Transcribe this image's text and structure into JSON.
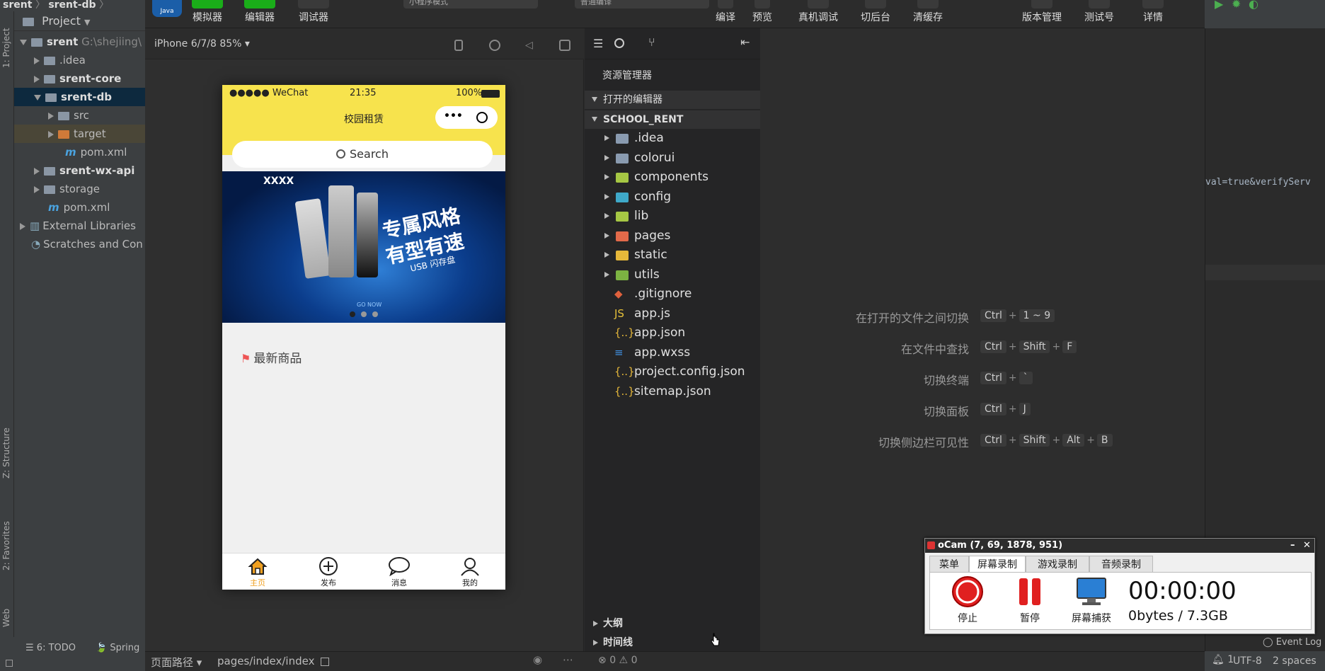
{
  "ij": {
    "breadcrumb": [
      "srent",
      "srent-db"
    ],
    "project_header": "Project",
    "side_tabs": {
      "project": "1: Project",
      "structure": "Z: Structure",
      "favorites": "2: Favorites",
      "web": "Web"
    },
    "tree": [
      {
        "label": "srent",
        "suffix": "G:\\shejiing\\",
        "expanded": true,
        "indent": 0
      },
      {
        "label": ".idea",
        "indent": 1
      },
      {
        "label": "srent-core",
        "indent": 1
      },
      {
        "label": "srent-db",
        "indent": 1,
        "expanded": true
      },
      {
        "label": "src",
        "indent": 2
      },
      {
        "label": "target",
        "indent": 2
      },
      {
        "label": "pom.xml",
        "indent": 2
      },
      {
        "label": "srent-wx-api",
        "indent": 1
      },
      {
        "label": "storage",
        "indent": 1
      },
      {
        "label": "pom.xml",
        "indent": 1
      },
      {
        "label": "External Libraries",
        "indent": 0
      },
      {
        "label": "Scratches and Con",
        "indent": 0
      }
    ],
    "bottom_tabs": {
      "todo": "6: TODO",
      "spring": "Spring"
    },
    "right": {
      "code_fragment": "val=true&verifyServ",
      "event_log": "Event Log",
      "encoding": "UTF-8",
      "indent": "2 spaces",
      "notif_count": "1"
    }
  },
  "toolbar": {
    "java_logo": "Java",
    "simulator": "模拟器",
    "editor": "编辑器",
    "debugger": "调试器",
    "mode_select": "小程序模式",
    "compile_select": "普通编译",
    "compile": "编译",
    "preview": "预览",
    "real_debug": "真机调试",
    "background": "切后台",
    "clear_cache": "清缓存",
    "version": "版本管理",
    "test_no": "测试号",
    "details": "详情"
  },
  "sim": {
    "device": "iPhone 6/7/8 85%",
    "phone": {
      "carrier": "●●●●● WeChat",
      "time": "21:35",
      "battery": "100%",
      "title": "校园租赁",
      "search": "Search",
      "banner_brand": "XXXX",
      "banner_line1": "专属风格",
      "banner_line2": "有型有速",
      "banner_line3": "USB 闪存盘",
      "banner_cta": "GO NOW",
      "latest": "最新商品",
      "tabs": [
        {
          "label": "主页",
          "icon": "home-icon"
        },
        {
          "label": "发布",
          "icon": "plus-circle-icon"
        },
        {
          "label": "消息",
          "icon": "chat-icon"
        },
        {
          "label": "我的",
          "icon": "user-icon"
        }
      ]
    }
  },
  "explorer": {
    "title": "资源管理器",
    "open_editors": "打开的编辑器",
    "project": "SCHOOL_RENT",
    "items": [
      {
        "label": ".idea",
        "type": "folder",
        "color": "#8a9bb0"
      },
      {
        "label": "colorui",
        "type": "folder",
        "color": "#8a9bb0"
      },
      {
        "label": "components",
        "type": "folder",
        "color": "#a6c744"
      },
      {
        "label": "config",
        "type": "folder",
        "color": "#3fa9c9"
      },
      {
        "label": "lib",
        "type": "folder",
        "color": "#a6c744"
      },
      {
        "label": "pages",
        "type": "folder",
        "color": "#e26a4a"
      },
      {
        "label": "static",
        "type": "folder",
        "color": "#e6b83a"
      },
      {
        "label": "utils",
        "type": "folder",
        "color": "#7cb342"
      },
      {
        "label": ".gitignore",
        "type": "file",
        "glyph": "◆",
        "color": "#e0613d"
      },
      {
        "label": "app.js",
        "type": "file",
        "glyph": "JS",
        "color": "#e6c13a"
      },
      {
        "label": "app.json",
        "type": "file",
        "glyph": "{..}",
        "color": "#e6b83a"
      },
      {
        "label": "app.wxss",
        "type": "file",
        "glyph": "≡",
        "color": "#3f8fe0"
      },
      {
        "label": "project.config.json",
        "type": "file",
        "glyph": "{..}",
        "color": "#e6b83a"
      },
      {
        "label": "sitemap.json",
        "type": "file",
        "glyph": "{..}",
        "color": "#e6b83a"
      }
    ],
    "outline": "大纲",
    "timeline": "时间线"
  },
  "editor": {
    "shortcuts": [
      {
        "label": "在打开的文件之间切换",
        "keys": [
          "Ctrl",
          "1 ~ 9"
        ]
      },
      {
        "label": "在文件中查找",
        "keys": [
          "Ctrl",
          "Shift",
          "F"
        ]
      },
      {
        "label": "切换终端",
        "keys": [
          "Ctrl",
          "`"
        ]
      },
      {
        "label": "切换面板",
        "keys": [
          "Ctrl",
          "J"
        ]
      },
      {
        "label": "切换侧边栏可见性",
        "keys": [
          "Ctrl",
          "Shift",
          "Alt",
          "B"
        ]
      }
    ]
  },
  "status": {
    "page_path_label": "页面路径",
    "page_path": "pages/index/index",
    "errors": "0",
    "warnings": "0"
  },
  "ocam": {
    "title": "oCam (7, 69, 1878, 951)",
    "tabs": [
      "菜单",
      "屏幕录制",
      "游戏录制",
      "音频录制"
    ],
    "active_tab": "屏幕录制",
    "stop": "停止",
    "pause": "暂停",
    "capture": "屏幕捕获",
    "time": "00:00:00",
    "size": "0bytes / 7.3GB"
  }
}
